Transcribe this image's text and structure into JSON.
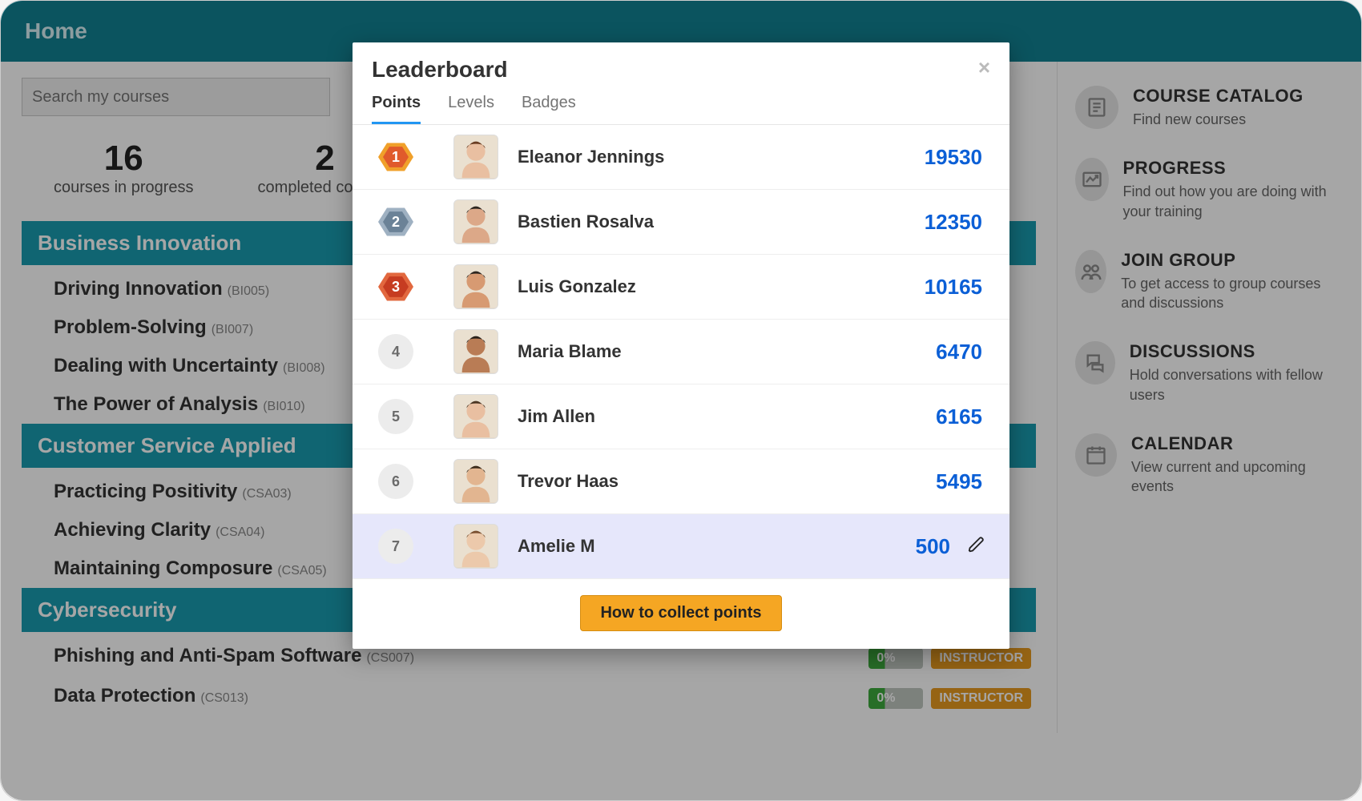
{
  "header": {
    "title": "Home"
  },
  "search": {
    "placeholder": "Search my courses"
  },
  "stats": [
    {
      "num": "16",
      "label": "courses in progress"
    },
    {
      "num": "2",
      "label": "completed courses"
    }
  ],
  "sections": [
    {
      "title": "Business Innovation",
      "courses": [
        {
          "name": "Driving Innovation",
          "code": "(BI005)"
        },
        {
          "name": "Problem-Solving",
          "code": "(BI007)"
        },
        {
          "name": "Dealing with Uncertainty",
          "code": "(BI008)"
        },
        {
          "name": "The Power of Analysis",
          "code": "(BI010)"
        }
      ]
    },
    {
      "title": "Customer Service Applied",
      "courses": [
        {
          "name": "Practicing Positivity",
          "code": "(CSA03)"
        },
        {
          "name": "Achieving Clarity",
          "code": "(CSA04)"
        },
        {
          "name": "Maintaining Composure",
          "code": "(CSA05)"
        }
      ]
    },
    {
      "title": "Cybersecurity",
      "courses": [
        {
          "name": "Phishing and Anti-Spam Software",
          "code": "(CS007)",
          "progress": "0%",
          "tag": "INSTRUCTOR"
        },
        {
          "name": "Data Protection",
          "code": "(CS013)",
          "progress": "0%",
          "tag": "INSTRUCTOR"
        }
      ]
    }
  ],
  "sidebar": [
    {
      "title": "COURSE CATALOG",
      "desc": "Find new courses",
      "icon": "catalog"
    },
    {
      "title": "PROGRESS",
      "desc": "Find out how you are doing with your training",
      "icon": "progress"
    },
    {
      "title": "JOIN GROUP",
      "desc": "To get access to group courses and discussions",
      "icon": "group"
    },
    {
      "title": "DISCUSSIONS",
      "desc": "Hold conversations with fellow users",
      "icon": "discussions"
    },
    {
      "title": "CALENDAR",
      "desc": "View current and upcoming events",
      "icon": "calendar"
    }
  ],
  "modal": {
    "title": "Leaderboard",
    "tabs": [
      "Points",
      "Levels",
      "Badges"
    ],
    "active_tab": 0,
    "button": "How to collect points",
    "rows": [
      {
        "rank": "1",
        "name": "Eleanor Jennings",
        "points": "19530",
        "badge": "hex",
        "me": false
      },
      {
        "rank": "2",
        "name": "Bastien Rosalva",
        "points": "12350",
        "badge": "hex",
        "me": false
      },
      {
        "rank": "3",
        "name": "Luis Gonzalez",
        "points": "10165",
        "badge": "hex",
        "me": false
      },
      {
        "rank": "4",
        "name": "Maria Blame",
        "points": "6470",
        "badge": "plain",
        "me": false
      },
      {
        "rank": "5",
        "name": "Jim Allen",
        "points": "6165",
        "badge": "plain",
        "me": false
      },
      {
        "rank": "6",
        "name": "Trevor Haas",
        "points": "5495",
        "badge": "plain",
        "me": false
      },
      {
        "rank": "7",
        "name": "Amelie M",
        "points": "500",
        "badge": "plain",
        "me": true
      }
    ]
  }
}
